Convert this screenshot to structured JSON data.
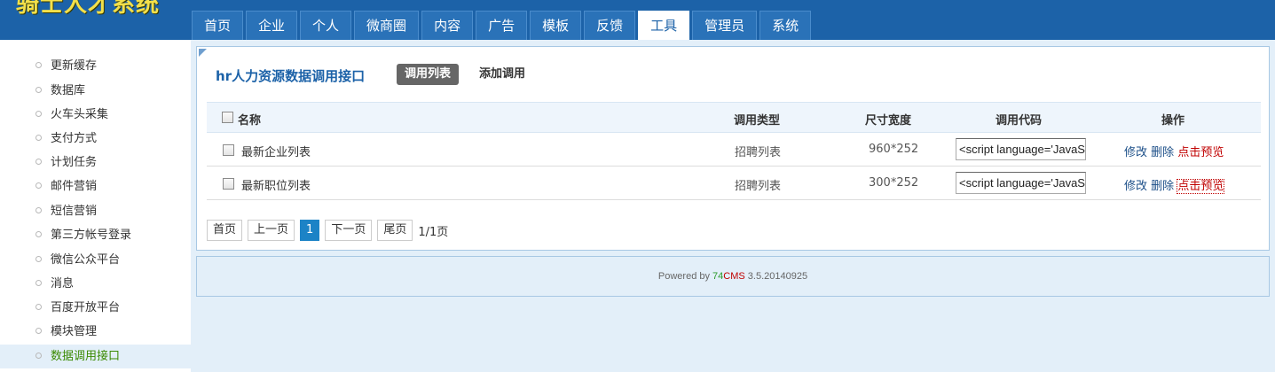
{
  "header": {
    "logo_text": "骑士人才系统",
    "nav": [
      {
        "label": "首页"
      },
      {
        "label": "企业"
      },
      {
        "label": "个人"
      },
      {
        "label": "微商圈"
      },
      {
        "label": "内容"
      },
      {
        "label": "广告"
      },
      {
        "label": "模板"
      },
      {
        "label": "反馈"
      },
      {
        "label": "工具",
        "active": true
      },
      {
        "label": "管理员"
      },
      {
        "label": "系统"
      }
    ]
  },
  "sidebar": {
    "items": [
      {
        "label": "更新缓存"
      },
      {
        "label": "数据库"
      },
      {
        "label": "火车头采集"
      },
      {
        "label": "支付方式"
      },
      {
        "label": "计划任务"
      },
      {
        "label": "邮件营销"
      },
      {
        "label": "短信营销"
      },
      {
        "label": "第三方帐号登录"
      },
      {
        "label": "微信公众平台"
      },
      {
        "label": "消息"
      },
      {
        "label": "百度开放平台"
      },
      {
        "label": "模块管理"
      },
      {
        "label": "数据调用接口",
        "active": true
      }
    ]
  },
  "main": {
    "title": "hr人力资源数据调用接口",
    "tabs": {
      "list": "调用列表",
      "add": "添加调用"
    },
    "table": {
      "headers": {
        "name": "名称",
        "type": "调用类型",
        "size": "尺寸宽度",
        "code": "调用代码",
        "ops": "操作"
      },
      "rows": [
        {
          "name": "最新企业列表",
          "type": "招聘列表",
          "size": "960*252",
          "code": "<script language='JavaScript'",
          "edit": "修改",
          "delete": "删除",
          "preview": "点击预览"
        },
        {
          "name": "最新职位列表",
          "type": "招聘列表",
          "size": "300*252",
          "code": "<script language='JavaScript'",
          "edit": "修改",
          "delete": "删除",
          "preview": "点击预览"
        }
      ]
    },
    "pager": {
      "first": "首页",
      "prev": "上一页",
      "current": "1",
      "next": "下一页",
      "last": "尾页",
      "info": "1/1页"
    }
  },
  "footer": {
    "prefix": "Powered by ",
    "brand_a": "74",
    "brand_b": "CMS",
    "version": " 3.5.20140925"
  },
  "colors": {
    "header_bg": "#1c62a8",
    "accent_green": "#3a8a00",
    "link_red": "#c00000"
  }
}
